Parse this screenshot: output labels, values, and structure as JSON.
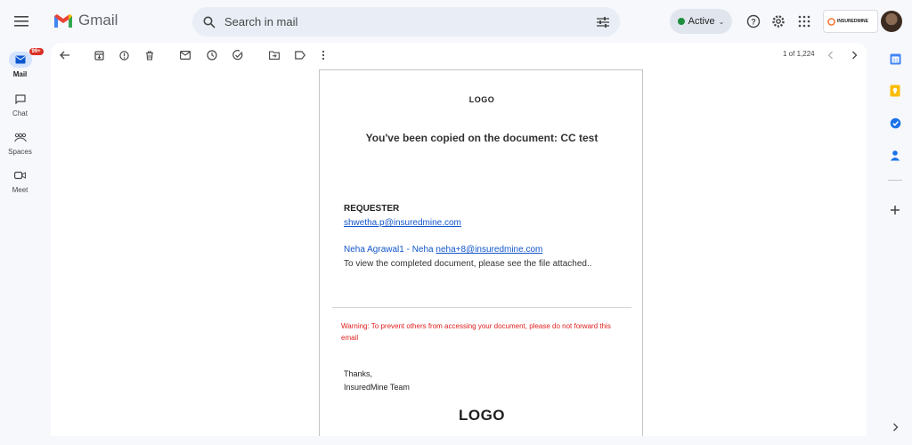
{
  "app": {
    "name": "Gmail"
  },
  "search": {
    "placeholder": "Search in mail"
  },
  "status": {
    "label": "Active"
  },
  "brand": {
    "name": "INSUREDMINE"
  },
  "nav": {
    "items": [
      {
        "label": "Mail",
        "badge": "99+"
      },
      {
        "label": "Chat"
      },
      {
        "label": "Spaces"
      },
      {
        "label": "Meet"
      }
    ]
  },
  "pager": {
    "text": "1 of 1,224"
  },
  "email": {
    "logo_top": "LOGO",
    "title": "You've been copied on the document: CC test",
    "requester_heading": "REQUESTER",
    "requester_email": "shwetha.p@insuredmine.com",
    "signer_name": "Neha Agrawal1 - Neha",
    "signer_email": "neha+8@insuredmine.com",
    "view_text": "To view the completed document, please see the file attached..",
    "warning": "Warning: To prevent others from accessing your document, please do not forward this email",
    "thanks": "Thanks,",
    "team": "InsuredMine Team",
    "logo_bottom": "LOGO"
  },
  "colors": {
    "accent": "#0b57d0",
    "warning": "#e02020",
    "active": "#1e8e3e"
  }
}
